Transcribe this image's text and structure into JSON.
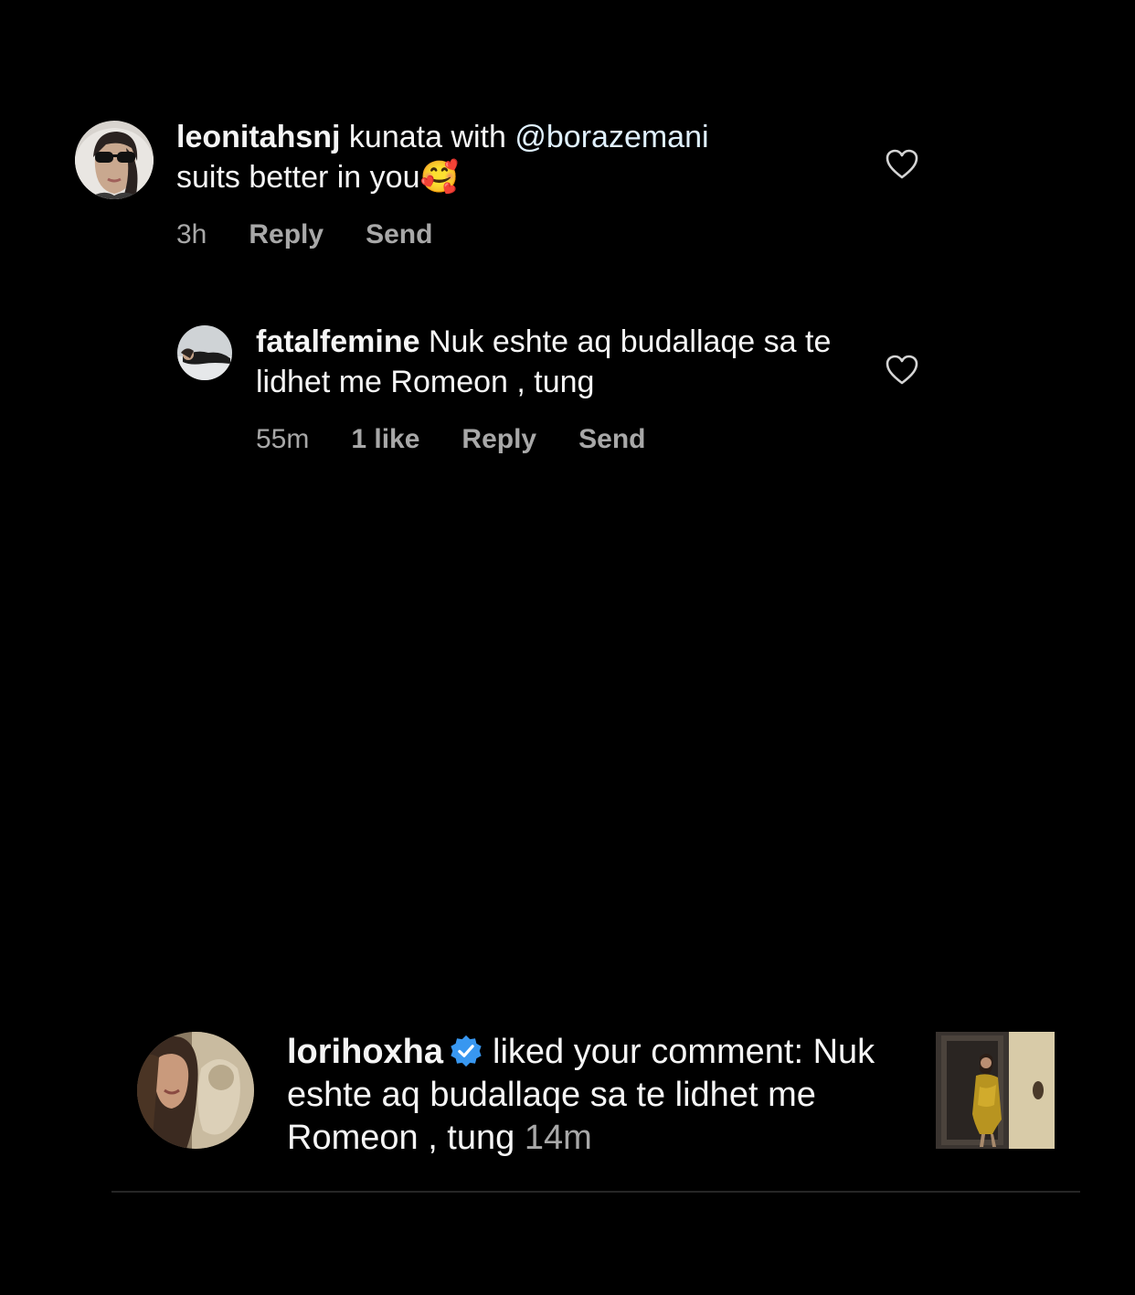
{
  "comments": [
    {
      "username": "leonitahsnj",
      "text_before_mention": "kunata with",
      "mention": "@borazemani",
      "text_after_mention": "suits better in you",
      "emoji": "🥰",
      "time": "3h",
      "reply_label": "Reply",
      "send_label": "Send"
    },
    {
      "username": "fatalfemine",
      "text": "Nuk eshte aq budallaqe sa te lidhet me Romeon , tung",
      "time": "55m",
      "likes": "1 like",
      "reply_label": "Reply",
      "send_label": "Send"
    }
  ],
  "notification": {
    "username": "lorihoxha",
    "verified": true,
    "action": "liked your comment:",
    "comment": "Nuk eshte aq budallaqe sa te lidhet me Romeon , tung",
    "time": "14m"
  },
  "icons": {
    "like": "heart-outline-icon",
    "verified": "verified-badge-icon"
  },
  "colors": {
    "background": "#000000",
    "text": "#f5f5f5",
    "secondary": "#a8a8a8",
    "mention": "#e0f1ff",
    "verified": "#3897f0",
    "divider": "#262626"
  }
}
